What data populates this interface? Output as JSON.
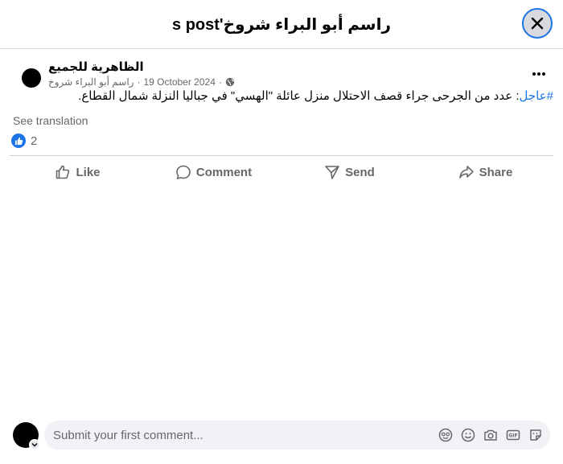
{
  "dialog": {
    "title": "s post'راسم أبو البراء شروخ"
  },
  "post": {
    "page_name": "الظاهرية للجميع",
    "author": "راسم أبو البراء شروخ",
    "separator": "·",
    "date": "19 October 2024",
    "privacy_icon": "globe-icon",
    "hashtag": "#عاجل",
    "text": ": عدد من الجرحى جراء قصف الاحتلال منزل عائلة \"الهسي\" في جباليا النزلة شمال القطاع.",
    "see_translation": "See translation",
    "reaction_count": "2"
  },
  "actions": [
    {
      "label": "Like",
      "icon": "thumbs-up-icon"
    },
    {
      "label": "Comment",
      "icon": "comment-icon"
    },
    {
      "label": "Send",
      "icon": "send-icon"
    },
    {
      "label": "Share",
      "icon": "share-icon"
    }
  ],
  "composer": {
    "placeholder": "Submit your first comment...",
    "icons": [
      "avatar-sticker-icon",
      "emoji-icon",
      "camera-icon",
      "gif-icon",
      "sticker-icon"
    ]
  },
  "colors": {
    "accent": "#1b74e4",
    "muted_text": "#65676b",
    "input_bg": "#f0f2f5"
  }
}
